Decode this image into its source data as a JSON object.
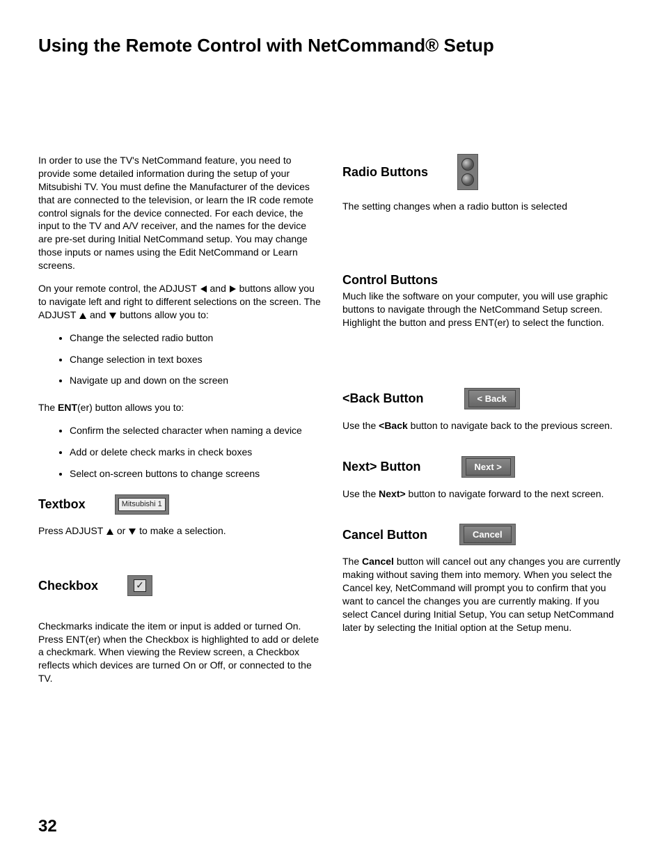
{
  "title": "Using the Remote Control with NetCommand® Setup",
  "page_number": "32",
  "left": {
    "intro": "In order to use the TV's NetCommand feature, you need to provide some detailed information during the setup of your Mitsubishi TV.  You must define the Manufacturer of the devices that are connected to the television, or learn the IR code remote control signals for the device connected.  For each device, the input to the TV and A/V receiver, and the names for the device are pre-set during Initial NetCommand setup.  You may change those inputs or names using the Edit NetCommand or Learn screens.",
    "adjust_para_a": "On your remote control, the ADJUST ",
    "adjust_para_b": " and ",
    "adjust_para_c": " buttons allow you to navigate left and right to different selections on the screen. The ADJUST ",
    "adjust_para_d": " and ",
    "adjust_para_e": " buttons allow you to:",
    "bullets1": [
      "Change the selected radio button",
      "Change selection in text boxes",
      "Navigate up and down on the screen"
    ],
    "ent_line_a": "The ",
    "ent_bold": "ENT",
    "ent_line_b": "(er) button allows you to:",
    "bullets2": [
      "Confirm the selected character when naming a device",
      "Add or delete check marks in check boxes",
      "Select on-screen buttons to change screens"
    ],
    "textbox_heading": "Textbox",
    "textbox_value": "Mitsubishi 1",
    "textbox_line_a": "Press ADJUST ",
    "textbox_line_b": " or ",
    "textbox_line_c": " to make a selection.",
    "checkbox_heading": "Checkbox",
    "checkbox_mark": "✓",
    "checkbox_body": "Checkmarks indicate the item or input is added or turned On.  Press ENT(er) when the Checkbox is highlighted to add or delete a checkmark. When viewing the Review screen, a Checkbox reflects which devices are turned On or Off, or connected to the TV."
  },
  "right": {
    "radio_heading": "Radio Buttons",
    "radio_body": "The setting changes when a radio button is selected",
    "control_heading": "Control Buttons",
    "control_body": "Much like the software on your computer, you will use graphic buttons to navigate through the NetCommand Setup screen.  Highlight the button and press ENT(er) to select the function.",
    "back_heading": "<Back Button",
    "back_label": "< Back",
    "back_body_a": "Use the ",
    "back_bold": "<Back",
    "back_body_b": " button to navigate back to the previous screen.",
    "next_heading": "Next> Button",
    "next_label": "Next >",
    "next_body_a": "Use the ",
    "next_bold": "Next>",
    "next_body_b": " button to navigate forward to the next screen.",
    "cancel_heading": "Cancel Button",
    "cancel_label": "Cancel",
    "cancel_body_a": "The ",
    "cancel_bold": "Cancel",
    "cancel_body_b": " button will cancel out any changes you are currently making without saving them into memory.  When you select the Cancel key, NetCommand will prompt you to confirm that you want to cancel the changes you are currently making.  If you select Cancel during Initial Setup, You can setup NetCommand later by selecting the Initial option at the Setup menu."
  }
}
